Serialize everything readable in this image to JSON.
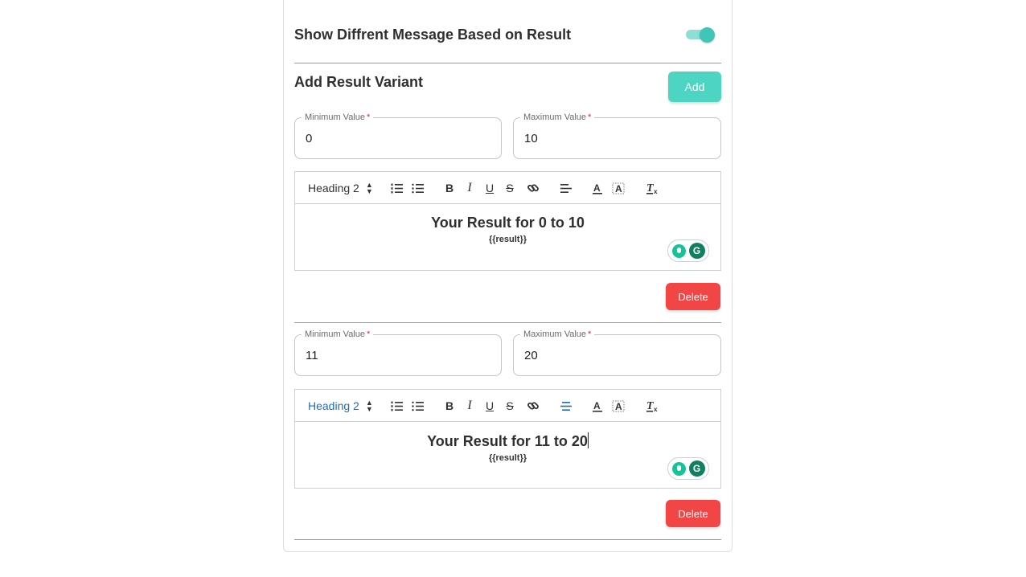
{
  "colors": {
    "accent": "#4dd4c2",
    "danger": "#f24545",
    "active_toolbar": "#1f6cc2"
  },
  "settings": {
    "toggle_label": "Show Diffrent Message Based on Result",
    "toggle_on": true
  },
  "variants_section": {
    "title": "Add Result Variant",
    "add_label": "Add"
  },
  "variants": [
    {
      "min_label": "Minimum Value",
      "min_value": "0",
      "max_label": "Maximum Value",
      "max_value": "10",
      "toolbar": {
        "heading": "Heading 2"
      },
      "content": {
        "heading": "Your Result for 0 to 10",
        "sub": "{{result}}"
      },
      "delete_label": "Delete"
    },
    {
      "min_label": "Minimum Value",
      "min_value": "11",
      "max_label": "Maximum Value",
      "max_value": "20",
      "toolbar": {
        "heading": "Heading 2"
      },
      "content": {
        "heading": "Your Result for 11 to 20",
        "sub": "{{result}}"
      },
      "delete_label": "Delete"
    }
  ],
  "required_mark": "*",
  "grammarly_letter": "G"
}
